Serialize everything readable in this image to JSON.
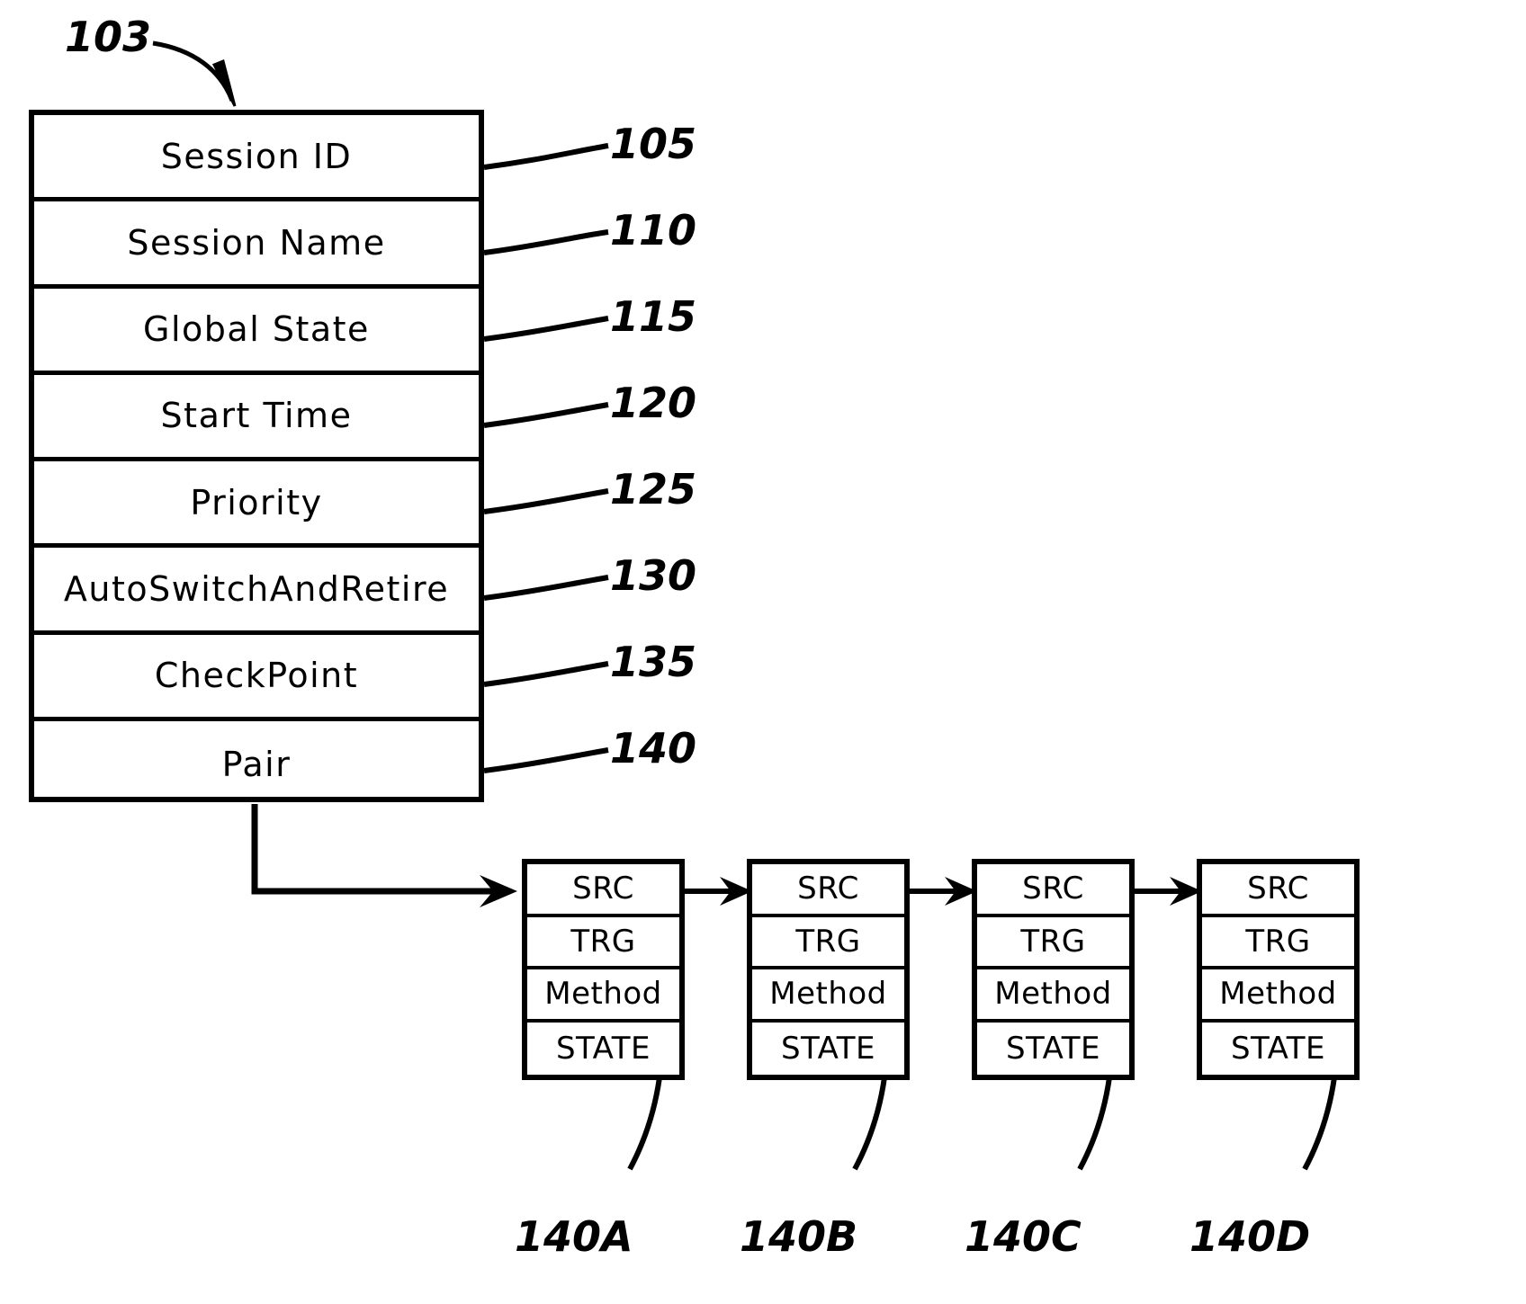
{
  "figure": {
    "struct_ref": "103",
    "struct_fields": [
      {
        "label": "Session ID",
        "ref": "105"
      },
      {
        "label": "Session  Name",
        "ref": "110"
      },
      {
        "label": "Global  State",
        "ref": "115"
      },
      {
        "label": "Start  Time",
        "ref": "120"
      },
      {
        "label": "Priority",
        "ref": "125"
      },
      {
        "label": "AutoSwitchAndRetire",
        "ref": "130"
      },
      {
        "label": "CheckPoint",
        "ref": "135"
      },
      {
        "label": "Pair",
        "ref": "140"
      }
    ],
    "pair_node_fields": [
      "SRC",
      "TRG",
      "Method",
      "STATE"
    ],
    "pair_nodes": [
      {
        "ref": "140A",
        "fields": [
          "SRC",
          "TRG",
          "Method",
          "STATE"
        ]
      },
      {
        "ref": "140B",
        "fields": [
          "SRC",
          "TRG",
          "Method",
          "STATE"
        ]
      },
      {
        "ref": "140C",
        "fields": [
          "SRC",
          "TRG",
          "Method",
          "STATE"
        ]
      },
      {
        "ref": "140D",
        "fields": [
          "SRC",
          "TRG",
          "Method",
          "STATE"
        ]
      }
    ],
    "colors": {
      "line": "#000000",
      "background": "#ffffff"
    }
  }
}
